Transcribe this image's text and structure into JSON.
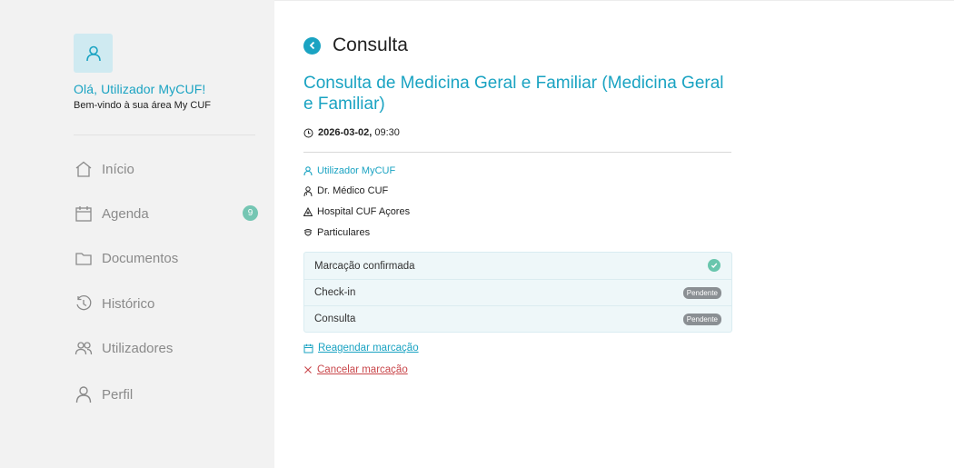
{
  "sidebar": {
    "greeting": "Olá, Utilizador MyCUF!",
    "welcome": "Bem-vindo à sua área My CUF",
    "nav": [
      {
        "label": "Início",
        "icon": "home-icon"
      },
      {
        "label": "Agenda",
        "icon": "calendar-icon",
        "badge": "9"
      },
      {
        "label": "Documentos",
        "icon": "folder-icon"
      },
      {
        "label": "Histórico",
        "icon": "history-icon"
      },
      {
        "label": "Utilizadores",
        "icon": "users-icon"
      },
      {
        "label": "Perfil",
        "icon": "user-icon"
      }
    ]
  },
  "main": {
    "page_title": "Consulta",
    "appointment_title": "Consulta de Medicina Geral e Familiar (Medicina Geral e Familiar)",
    "date": "2026-03-02,",
    "time": "09:30",
    "patient": "Utilizador MyCUF",
    "doctor": "Dr. Médico CUF",
    "hospital": "Hospital CUF Açores",
    "insurance": "Particulares",
    "status": [
      {
        "label": "Marcação confirmada",
        "state": "confirmed"
      },
      {
        "label": "Check-in",
        "state": "Pendente"
      },
      {
        "label": "Consulta",
        "state": "Pendente"
      }
    ],
    "reschedule": "Reagendar marcação",
    "cancel": "Cancelar marcação"
  },
  "colors": {
    "accent": "#1aa3c2",
    "badge": "#75c6b3",
    "success": "#69c6ad",
    "danger": "#c9474b",
    "sidebar_bg": "#f2f2f2"
  }
}
